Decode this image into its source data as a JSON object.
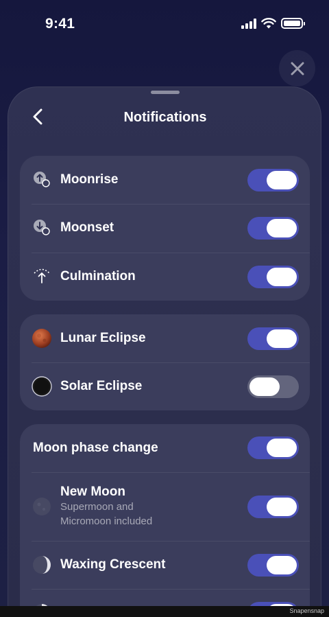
{
  "status_bar": {
    "time": "9:41"
  },
  "header": {
    "title": "Notifications"
  },
  "events_card": [
    {
      "label": "Moonrise",
      "icon": "moonrise-icon",
      "on": true
    },
    {
      "label": "Moonset",
      "icon": "moonset-icon",
      "on": true
    },
    {
      "label": "Culmination",
      "icon": "culmination-icon",
      "on": true
    }
  ],
  "eclipse_card": [
    {
      "label": "Lunar Eclipse",
      "icon": "lunar-eclipse-icon",
      "on": true
    },
    {
      "label": "Solar Eclipse",
      "icon": "solar-eclipse-icon",
      "on": false
    }
  ],
  "phase_card": {
    "master": {
      "label": "Moon phase change",
      "on": true
    },
    "items": [
      {
        "label": "New Moon",
        "sublabel_line1": "Supermoon and",
        "sublabel_line2": "Micromoon included",
        "icon": "new-moon-icon",
        "on": true
      },
      {
        "label": "Waxing Crescent",
        "icon": "waxing-crescent-icon",
        "on": true
      },
      {
        "label": "",
        "icon": "first-quarter-icon",
        "on": true
      }
    ]
  },
  "colors": {
    "accent": "#4a50b8",
    "toggle_off": "#63657d",
    "card": "#3b3d5c",
    "sheet": "#2f3152",
    "background": "#15173d"
  },
  "footer": {
    "watermark": "Snapensnap"
  }
}
